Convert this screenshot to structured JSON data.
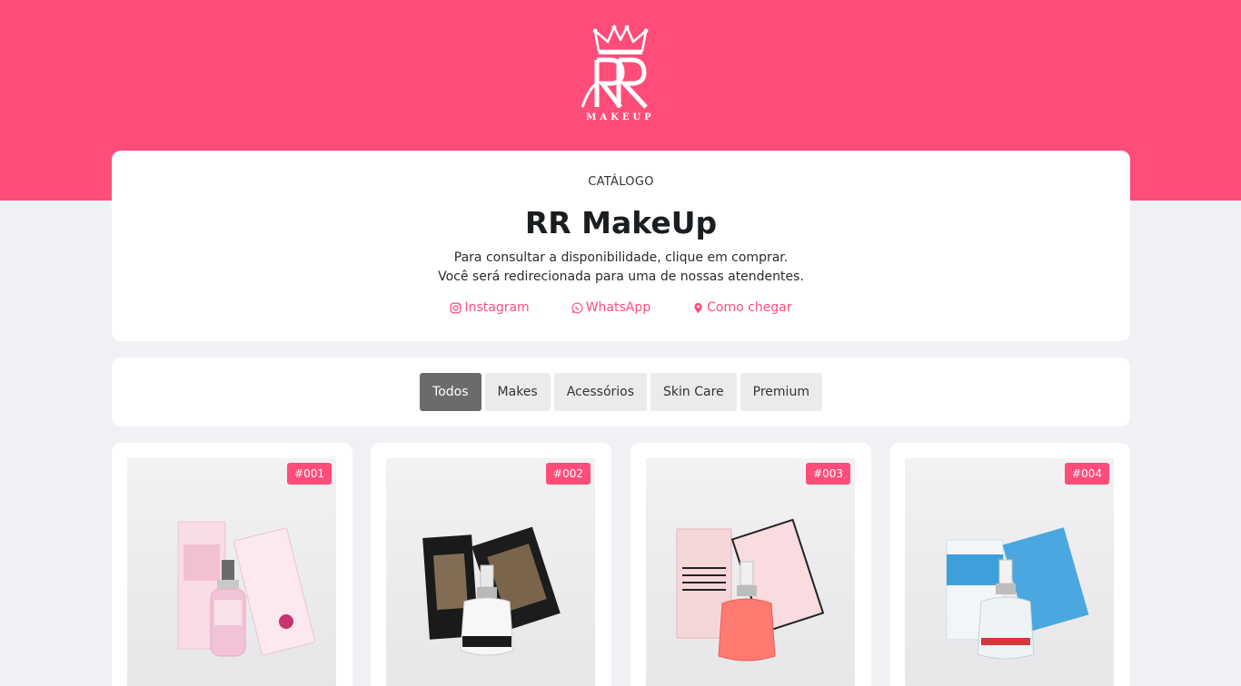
{
  "brand": {
    "logo_text": "MAKEUP",
    "accent_color": "#ff4d79"
  },
  "header": {
    "eyebrow": "CATÁLOGO",
    "title": "RR MakeUp",
    "description_line1": "Para consultar a disponibilidade, clique em comprar.",
    "description_line2": "Você será redirecionada para uma de nossas atendentes."
  },
  "links": [
    {
      "label": "Instagram",
      "icon": "instagram-icon"
    },
    {
      "label": "WhatsApp",
      "icon": "whatsapp-icon"
    },
    {
      "label": "Como chegar",
      "icon": "map-pin-icon"
    }
  ],
  "filters": [
    {
      "label": "Todos",
      "active": true
    },
    {
      "label": "Makes",
      "active": false
    },
    {
      "label": "Acessórios",
      "active": false
    },
    {
      "label": "Skin Care",
      "active": false
    },
    {
      "label": "Premium",
      "active": false
    }
  ],
  "products": [
    {
      "badge": "#001",
      "box_color": "#f7dbe6",
      "liquid_color": "#f3c6d8"
    },
    {
      "badge": "#002",
      "box_color": "#1a1a1a",
      "liquid_color": "#f4f4f4"
    },
    {
      "badge": "#003",
      "box_color": "#f6d7d9",
      "liquid_color": "#ff6f68"
    },
    {
      "badge": "#004",
      "box_color": "#49a6e0",
      "liquid_color": "#eef4f7"
    }
  ]
}
